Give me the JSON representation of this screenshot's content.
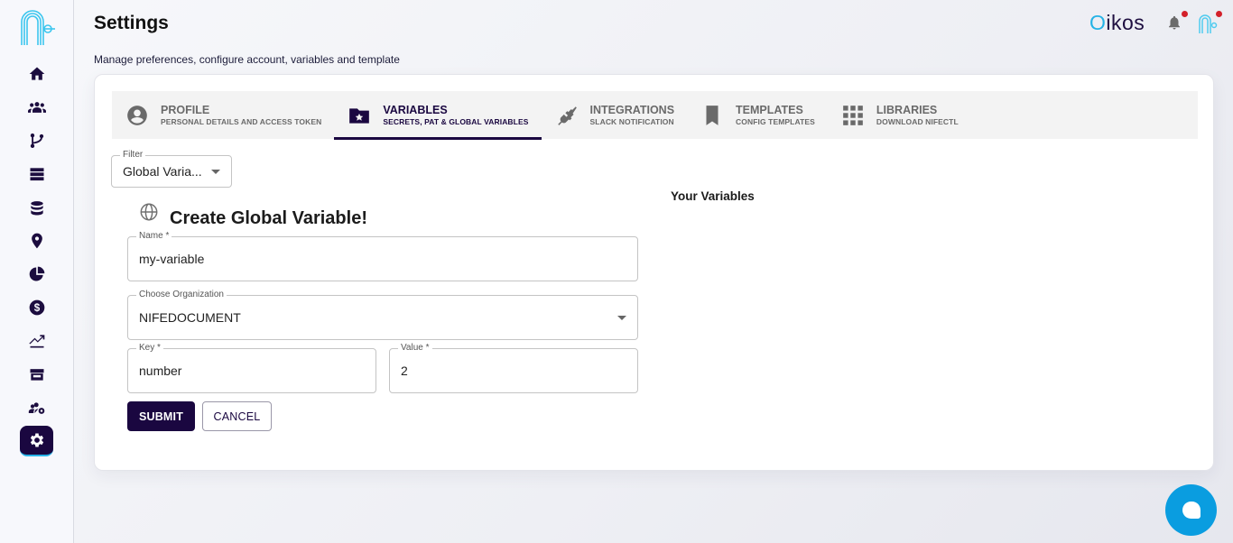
{
  "header": {
    "title": "Settings",
    "subtitle": "Manage preferences, configure account, variables and template",
    "brand_first": "O",
    "brand_rest": "ikos"
  },
  "sidebar": {
    "items": [
      {
        "name": "home",
        "icon": "home-icon"
      },
      {
        "name": "teams",
        "icon": "group-icon"
      },
      {
        "name": "branches",
        "icon": "git-branch-icon"
      },
      {
        "name": "servers",
        "icon": "server-icon"
      },
      {
        "name": "database",
        "icon": "database-icon"
      },
      {
        "name": "location",
        "icon": "location-pin-icon"
      },
      {
        "name": "analytics",
        "icon": "pie-chart-icon"
      },
      {
        "name": "billing",
        "icon": "dollar-icon"
      },
      {
        "name": "metrics",
        "icon": "trending-icon"
      },
      {
        "name": "store",
        "icon": "store-icon"
      },
      {
        "name": "user-management",
        "icon": "users-gear-icon"
      },
      {
        "name": "settings",
        "icon": "gear-icon",
        "active": true
      }
    ]
  },
  "tabs": [
    {
      "label": "PROFILE",
      "sublabel": "PERSONAL DETAILS AND ACCESS TOKEN",
      "icon": "account-circle-icon",
      "active": false
    },
    {
      "label": "VARIABLES",
      "sublabel": "SECRETS, PAT & GLOBAL VARIABLES",
      "icon": "folder-star-icon",
      "active": true
    },
    {
      "label": "INTEGRATIONS",
      "sublabel": "SLACK NOTIFICATION",
      "icon": "plug-icon",
      "active": false
    },
    {
      "label": "TEMPLATES",
      "sublabel": "CONFIG TEMPLATES",
      "icon": "bookmark-icon",
      "active": false
    },
    {
      "label": "LIBRARIES",
      "sublabel": "DOWNLOAD NIFECTL",
      "icon": "apps-grid-icon",
      "active": false
    }
  ],
  "filter": {
    "label": "Filter",
    "value": "Global Varia..."
  },
  "form": {
    "title": "Create Global Variable!",
    "name": {
      "label": "Name *",
      "value": "my-variable"
    },
    "organization": {
      "label": "Choose Organization",
      "value": "NIFEDOCUMENT"
    },
    "key": {
      "label": "Key *",
      "value": "number"
    },
    "value": {
      "label": "Value *",
      "value": "2"
    },
    "submit_label": "SUBMIT",
    "cancel_label": "CANCEL"
  },
  "variables_panel": {
    "title": "Your Variables"
  },
  "colors": {
    "primary": "#1a0740",
    "accent": "#24b2e6",
    "chat": "#0a9de0",
    "notification_dot": "#d3202a"
  }
}
